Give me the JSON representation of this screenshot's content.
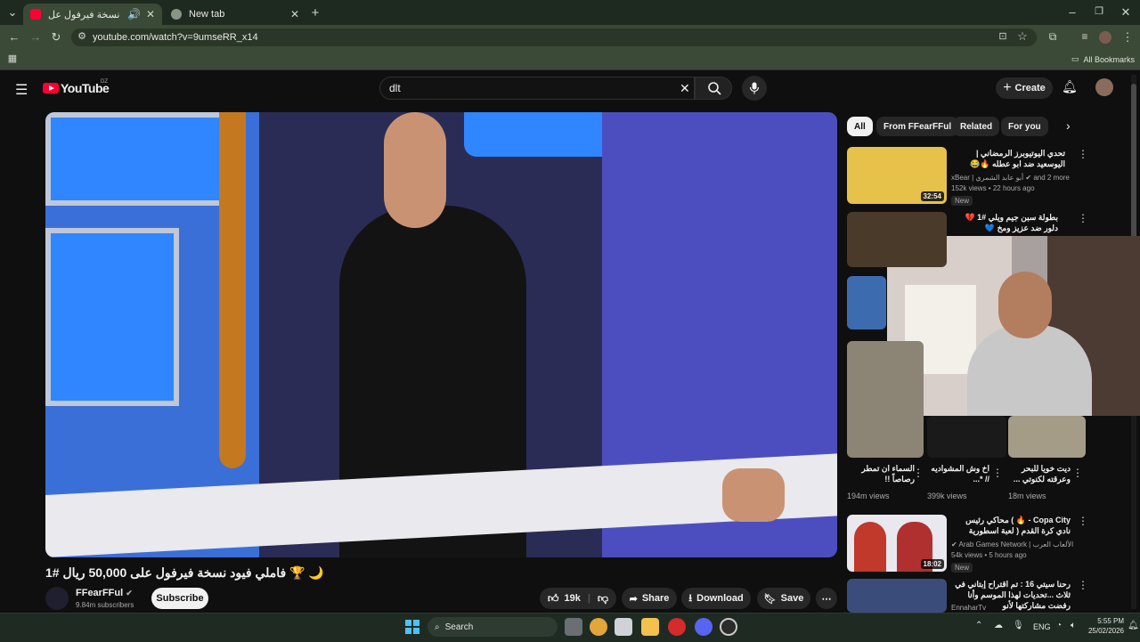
{
  "browser": {
    "tabs": [
      {
        "title": "فاملي فيود نسخة فيرفول عل...",
        "active": true,
        "audio": "🔊"
      },
      {
        "title": "New tab",
        "active": false
      }
    ],
    "url": "youtube.com/watch?v=9umseRR_x14",
    "all_bookmarks": "All Bookmarks"
  },
  "youtube": {
    "logo_text": "YouTube",
    "region": "DZ",
    "search_query": "dlt",
    "create_label": "Create",
    "video": {
      "title": "🌙 🏆 فاملي فيود نسخة فيرفول على 50,000 ريال #1",
      "channel": "FFearFFul",
      "subscribers": "9.84m subscribers",
      "subscribe": "Subscribe",
      "likes": "19k",
      "share": "Share",
      "download": "Download",
      "save": "Save"
    },
    "chips": [
      "All",
      "From FFearFFul",
      "Related",
      "For you"
    ],
    "recs": [
      {
        "title": "تحدي اليوتيوبرز الرمضاني | اليوسعيد ضد ابو عطله 🔥😂",
        "channel": "xBear | أبو عابد الشمري",
        "and_more": "and 2 more",
        "meta": "152k views • 22 hours ago",
        "duration": "32:54",
        "badge": "New"
      },
      {
        "title": "بطولة سبن جيم ويلي #1 💔 دلور ضد عزيز ومخ 💙"
      },
      {
        "title": "Copa City - 🔥 ) محاكي رئيس نادي كرة القدم ( لعبة اسطورية",
        "channel": "Arab Games Network | شبكة الألعاب العرب",
        "meta": "54k views • 5 hours ago",
        "duration": "18:02",
        "badge": "New"
      },
      {
        "title": "رحنا سيتي 16 : تم اقتراح إبتاني في ثلاث ...تحديات لهذا الموسم وأنا رفضت مشاركتها لأنو",
        "channel": "EnnaharTv"
      }
    ],
    "shorts": [
      {
        "title": "السماء ان تمطر رصاصاً !!",
        "views": "194m views"
      },
      {
        "title": "اخ وش المشواديه // *...",
        "views": "399k views"
      },
      {
        "title": "ديت خويا للبحر وعرقته لكنوتي ...",
        "views": "18m views"
      }
    ]
  },
  "taskbar": {
    "search": "Search",
    "lang": "ENG",
    "time": "5:55 PM",
    "date": "25/02/2026"
  },
  "colors": {
    "yt_red": "#ff0033",
    "chrome_green": "#3a4a36",
    "subscribe_bg": "#f1f1f1"
  }
}
